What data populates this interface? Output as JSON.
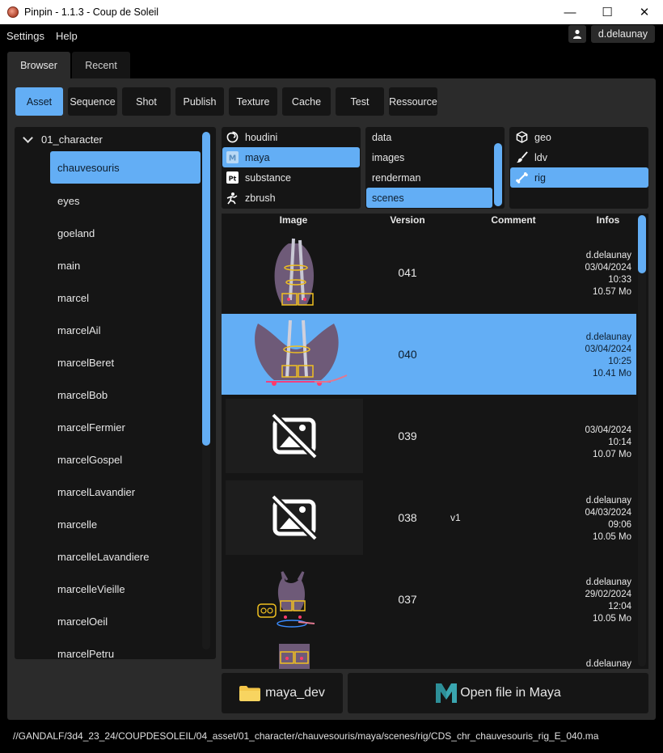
{
  "window": {
    "title": "Pinpin - 1.1.3 - Coup de Soleil",
    "controls": [
      "—",
      "☐",
      "✕"
    ]
  },
  "menu": {
    "items": [
      "Settings",
      "Help"
    ]
  },
  "user": {
    "name": "d.delaunay"
  },
  "tabs": [
    "Browser",
    "Recent"
  ],
  "categories": [
    "Asset",
    "Sequence",
    "Shot",
    "Publish",
    "Texture",
    "Cache",
    "Test",
    "Ressource"
  ],
  "tree": {
    "root": "01_character",
    "items": [
      "chauvesouris",
      "eyes",
      "goeland",
      "main",
      "marcel",
      "marcelAil",
      "marcelBeret",
      "marcelBob",
      "marcelFermier",
      "marcelGospel",
      "marcelLavandier",
      "marcelle",
      "marcelleLavandiere",
      "marcelleVieille",
      "marcelOeil",
      "marcelPetru"
    ]
  },
  "software": [
    "houdini",
    "maya",
    "substance",
    "zbrush"
  ],
  "folders": [
    "data",
    "images",
    "renderman",
    "scenes"
  ],
  "departments": [
    "geo",
    "ldv",
    "rig"
  ],
  "table": {
    "headers": [
      "Image",
      "Version",
      "Comment",
      "Infos"
    ],
    "rows": [
      {
        "version": "041",
        "comment": "",
        "info": [
          "d.delaunay",
          "03/04/2024",
          "10:33",
          "10.57 Mo"
        ]
      },
      {
        "version": "040",
        "comment": "",
        "info": [
          "d.delaunay",
          "03/04/2024",
          "10:25",
          "10.41 Mo"
        ]
      },
      {
        "version": "039",
        "comment": "",
        "info": [
          "03/04/2024",
          "10:14",
          "10.07 Mo"
        ]
      },
      {
        "version": "038",
        "comment": "v1",
        "info": [
          "d.delaunay",
          "04/03/2024",
          "09:06",
          "10.05 Mo"
        ]
      },
      {
        "version": "037",
        "comment": "",
        "info": [
          "d.delaunay",
          "29/02/2024",
          "12:04",
          "10.05 Mo"
        ]
      },
      {
        "version": "",
        "comment": "",
        "info": [
          "d.delaunay"
        ]
      }
    ]
  },
  "actions": {
    "folder": "maya_dev",
    "open": "Open file in Maya"
  },
  "path": "//GANDALF/3d4_23_24/COUPDESOLEIL/04_asset/01_character/chauvesouris/maya/scenes/rig/CDS_chr_chauvesouris_rig_E_040.ma",
  "colors": {
    "accent": "#63aef5",
    "panel": "#2b2b2b",
    "dark": "#151515",
    "maya": "#3aa6b0"
  }
}
